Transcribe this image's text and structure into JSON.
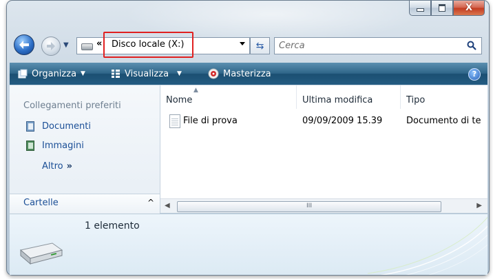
{
  "window": {
    "caption_buttons": {
      "minimize": "minimize",
      "maximize": "maximize",
      "close": "X"
    }
  },
  "address_bar": {
    "chevron": "«",
    "path": "Disco locale (X:)"
  },
  "search": {
    "placeholder": "Cerca"
  },
  "command_bar": {
    "organize_label": "Organizza",
    "view_label": "Visualizza",
    "burn_label": "Masterizza",
    "help_label": "?"
  },
  "navigation_pane": {
    "favorites_heading": "Collegamenti preferiti",
    "items": [
      {
        "label": "Documenti",
        "icon": "documents-icon"
      },
      {
        "label": "Immagini",
        "icon": "pictures-icon"
      }
    ],
    "more_label": "Altro",
    "more_chevron": "»",
    "folders_label": "Cartelle",
    "folders_caret": "^"
  },
  "file_list": {
    "columns": [
      "Nome",
      "Ultima modifica",
      "Tipo"
    ],
    "rows": [
      {
        "name": "File di prova",
        "modified": "09/09/2009 15.39",
        "type": "Documento di te"
      }
    ],
    "scroll_thumb": "III"
  },
  "details_pane": {
    "count": "1 elemento"
  },
  "colors": {
    "command_bar": "#2f6689",
    "link": "#1a4e96",
    "highlight_box": "#e02020",
    "close_button": "#c33a20"
  }
}
